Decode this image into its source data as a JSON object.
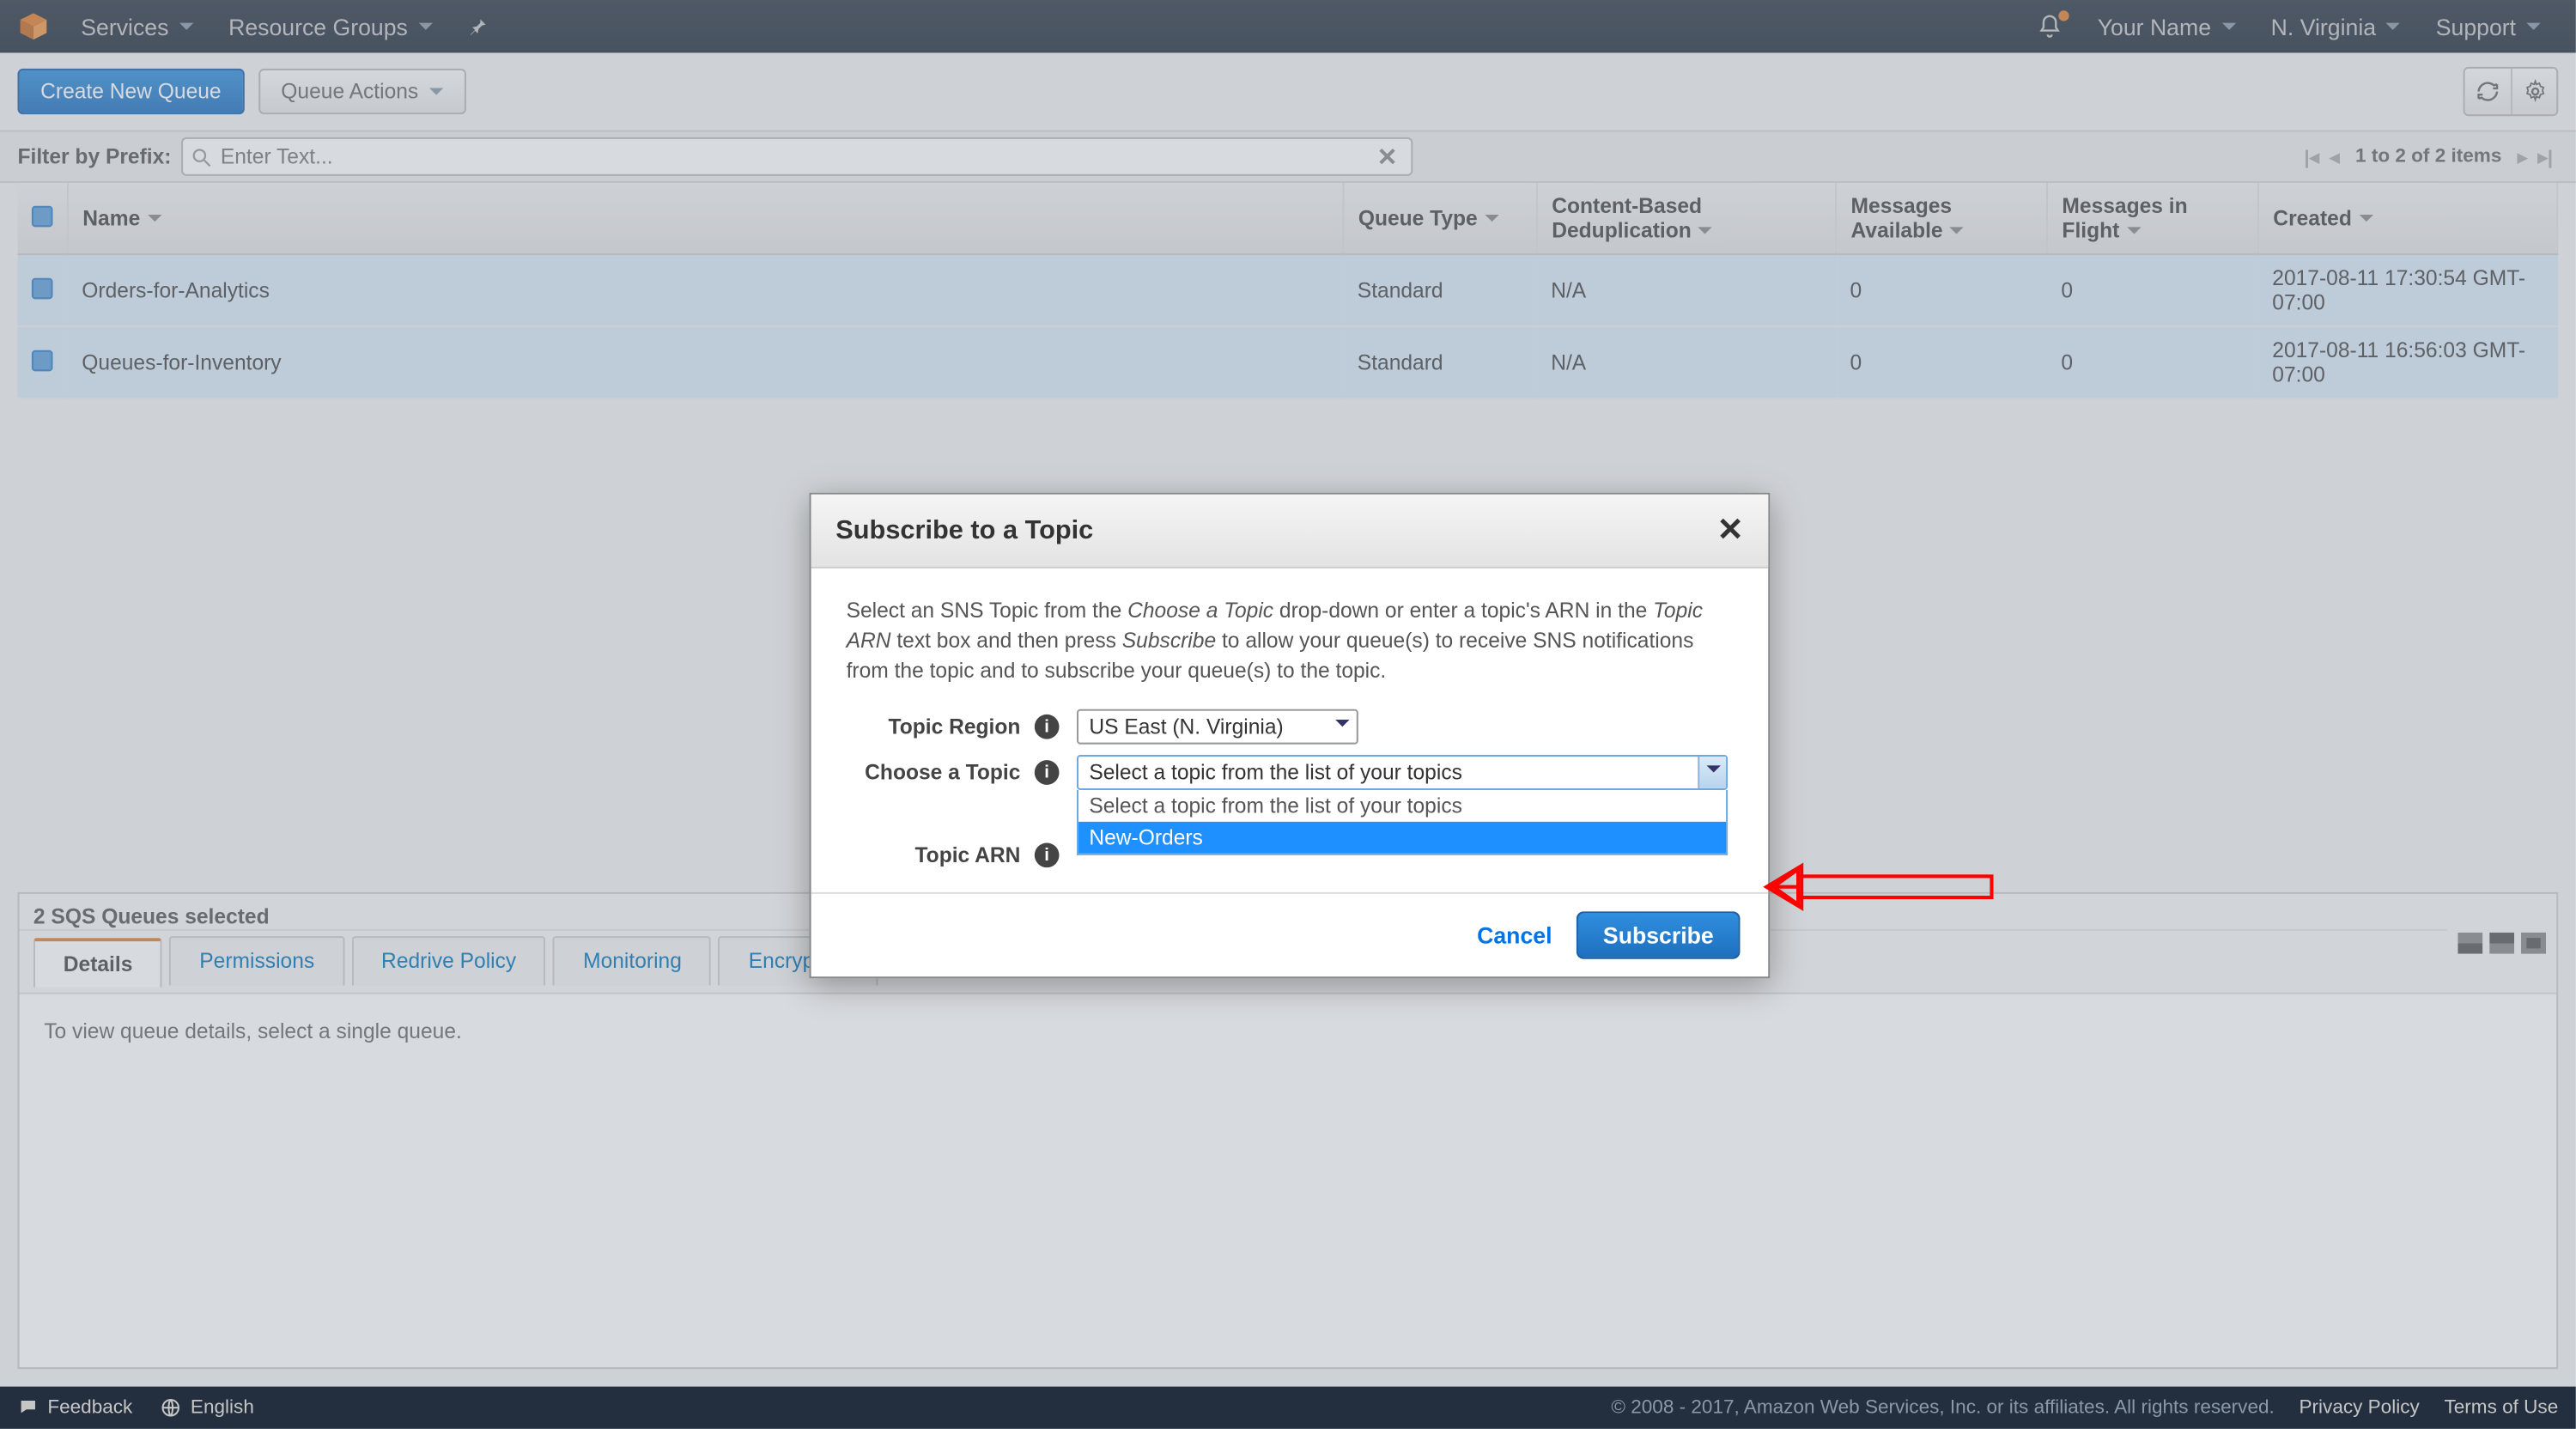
{
  "topnav": {
    "services": "Services",
    "resource_groups": "Resource Groups",
    "your_name": "Your Name",
    "region": "N. Virginia",
    "support": "Support"
  },
  "toolbar": {
    "create_queue": "Create New Queue",
    "queue_actions": "Queue Actions"
  },
  "filter": {
    "label": "Filter by Prefix:",
    "placeholder": "Enter Text...",
    "pager_text": "1 to 2 of 2 items"
  },
  "columns": {
    "name": "Name",
    "queue_type": "Queue Type",
    "cbd": "Content-Based Deduplication",
    "msg_avail": "Messages Available",
    "msg_flight": "Messages in Flight",
    "created": "Created"
  },
  "rows": [
    {
      "name": "Orders-for-Analytics",
      "type": "Standard",
      "cbd": "N/A",
      "avail": "0",
      "flight": "0",
      "created": "2017-08-11 17:30:54 GMT-07:00"
    },
    {
      "name": "Queues-for-Inventory",
      "type": "Standard",
      "cbd": "N/A",
      "avail": "0",
      "flight": "0",
      "created": "2017-08-11 16:56:03 GMT-07:00"
    }
  ],
  "lower": {
    "selected_text": "2 SQS Queues selected",
    "tabs": {
      "details": "Details",
      "permissions": "Permissions",
      "redrive": "Redrive Policy",
      "monitoring": "Monitoring",
      "encryption": "Encryption"
    },
    "details_msg": "To view queue details, select a single queue."
  },
  "modal": {
    "title": "Subscribe to a Topic",
    "desc_pre": "Select an SNS Topic from the ",
    "desc_choose": "Choose a Topic",
    "desc_mid1": " drop-down or enter a topic's ARN in the ",
    "desc_arn": "Topic ARN",
    "desc_mid2": " text box and then press ",
    "desc_sub": "Subscribe",
    "desc_post": " to allow your queue(s) to receive SNS notifications from the topic and to subscribe your queue(s) to the topic.",
    "labels": {
      "region": "Topic Region",
      "choose": "Choose a Topic",
      "arn": "Topic ARN"
    },
    "region_value": "US East (N. Virginia)",
    "choose_value": "Select a topic from the list of your topics",
    "options": {
      "placeholder": "Select a topic from the list of your topics",
      "new_orders": "New-Orders"
    },
    "cancel": "Cancel",
    "subscribe": "Subscribe"
  },
  "footer": {
    "feedback": "Feedback",
    "language": "English",
    "copyright": "© 2008 - 2017, Amazon Web Services, Inc. or its affiliates. All rights reserved.",
    "privacy": "Privacy Policy",
    "terms": "Terms of Use"
  }
}
